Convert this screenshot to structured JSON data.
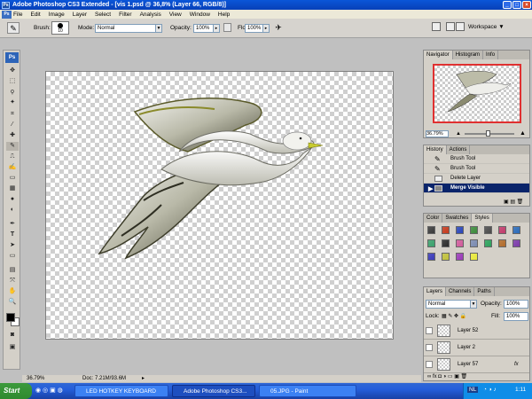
{
  "window": {
    "title": "Adobe Photoshop CS3 Extended - [vis 1.psd @ 36,8% (Layer 66, RGB/8)]"
  },
  "menu": [
    "File",
    "Edit",
    "Image",
    "Layer",
    "Select",
    "Filter",
    "Analysis",
    "View",
    "Window",
    "Help"
  ],
  "options": {
    "brush_label": "Brush:",
    "brush_size": "10",
    "mode_label": "Mode:",
    "mode_value": "Normal",
    "opacity_label": "Opacity:",
    "opacity_value": "100%",
    "flow_label": "Flow:",
    "flow_value": "100%",
    "workspace_label": "Workspace"
  },
  "status": {
    "zoom": "36.79%",
    "doc": "Doc: 7.21M/93.6M"
  },
  "navigator": {
    "tabs": [
      "Navigator",
      "Histogram",
      "Info"
    ],
    "zoom": "36.79%"
  },
  "history": {
    "tabs": [
      "History",
      "Actions"
    ],
    "items": [
      "Brush Tool",
      "Brush Tool",
      "Delete Layer",
      "Merge Visible"
    ]
  },
  "styles_panel": {
    "tabs": [
      "Color",
      "Swatches",
      "Styles"
    ],
    "swatch_colors": [
      "#3a3a3a",
      "#c43a1c",
      "#2a46b8",
      "#3c8a3a",
      "#4a4a4a",
      "#c03a6a",
      "#2a6ab8",
      "#3aa06a",
      "#2a2a2a",
      "#d05a9a",
      "#7a8ab0",
      "#2aa05a",
      "#b06a2a",
      "#7a3aa8",
      "#3a3ab8",
      "#c0c03a",
      "#9a3ab8",
      "#e8e83a"
    ]
  },
  "layers": {
    "tabs": [
      "Layers",
      "Channels",
      "Paths"
    ],
    "blend_mode": "Normal",
    "opacity_label": "Opacity:",
    "opacity_value": "100%",
    "lock_label": "Lock:",
    "fill_label": "Fill:",
    "fill_value": "100%",
    "rows": [
      "Layer 52",
      "Layer 2",
      "Layer 57"
    ]
  },
  "taskbar": {
    "start": "Start",
    "tasks": [
      "LED HOTKEY KEYBOARD",
      "Adobe Photoshop CS3...",
      "05.JPG - Paint"
    ],
    "lang": "NL",
    "clock": "1:11"
  },
  "colors": {
    "title_bar": "#0a56d8",
    "selection": "#0a246a",
    "nav_box": "#e03030"
  }
}
